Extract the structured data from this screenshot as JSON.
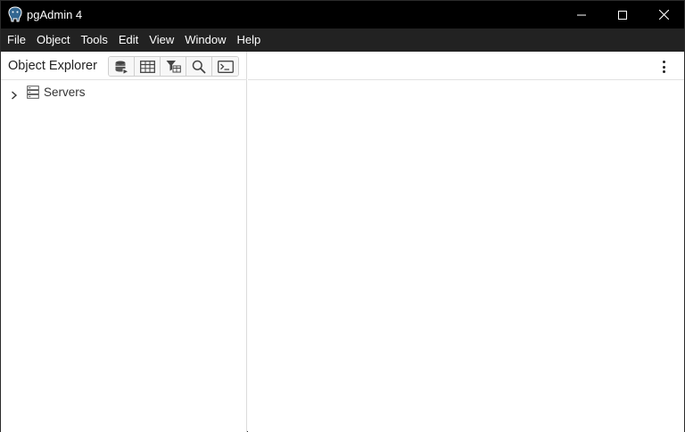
{
  "window": {
    "title": "pgAdmin 4",
    "icon": "pgadmin-elephant-icon"
  },
  "titlebar_controls": [
    "minimize-icon",
    "maximize-icon",
    "close-icon"
  ],
  "menu": {
    "items": [
      "File",
      "Object",
      "Tools",
      "Edit",
      "View",
      "Window",
      "Help"
    ]
  },
  "object_explorer": {
    "title": "Object Explorer",
    "toolbar": [
      "database-icon",
      "table-icon",
      "filter-table-icon",
      "search-icon",
      "terminal-icon"
    ],
    "tree": [
      {
        "label": "Servers",
        "expanded": false,
        "icon": "server-group-icon"
      }
    ]
  },
  "main_panel": {
    "menu_icon": "more-vertical-icon"
  },
  "colors": {
    "titlebar": "#000000",
    "menubar": "#222222",
    "panel_bg": "#ffffff",
    "border": "#dcdcdc"
  }
}
